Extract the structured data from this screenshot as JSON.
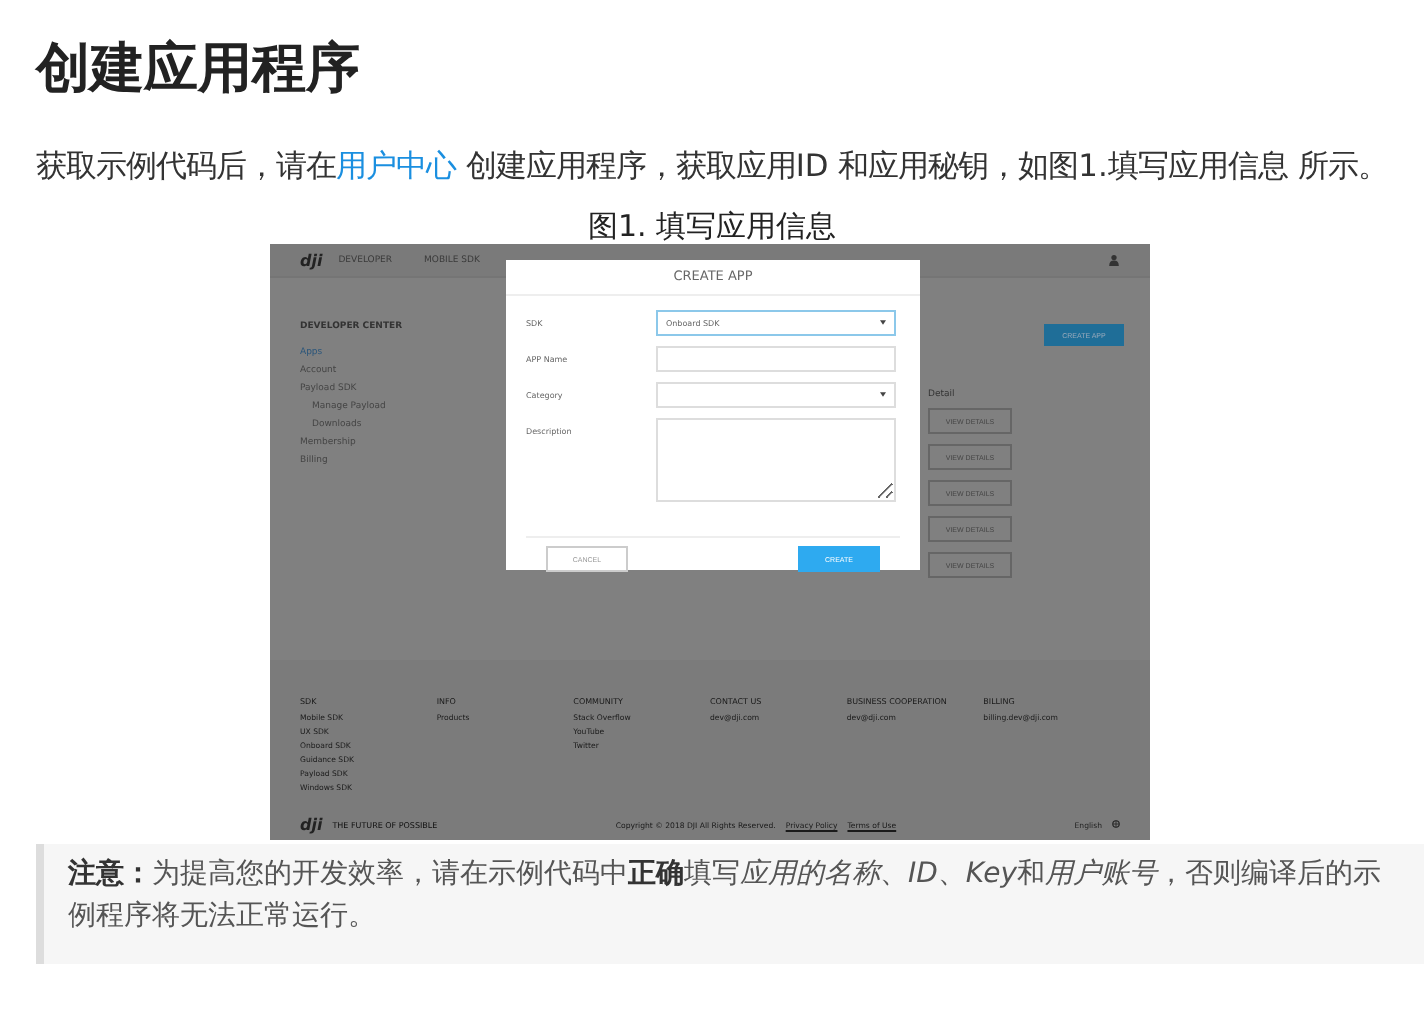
{
  "title": "创建应用程序",
  "intro": {
    "before": "获取示例代码后，请在",
    "link": "用户中心",
    "after": " 创建应用程序，获取应用ID 和应用秘钥，如图1.填写应用信息 所示。"
  },
  "figure_caption": "图1. 填写应用信息",
  "screenshot": {
    "nav": {
      "logo": "dji",
      "brand": "DEVELOPER",
      "items": [
        "MOBILE SDK"
      ]
    },
    "sidebar": {
      "heading": "DEVELOPER CENTER",
      "items": [
        {
          "label": "Apps",
          "selected": true
        },
        {
          "label": "Account",
          "selected": false
        },
        {
          "label": "Payload SDK",
          "selected": false,
          "children": [
            {
              "label": "Manage Payload",
              "selected": false
            },
            {
              "label": "Downloads",
              "selected": false
            }
          ]
        },
        {
          "label": "Membership",
          "selected": false
        },
        {
          "label": "Billing",
          "selected": false
        }
      ]
    },
    "create_button": "CREATE APP",
    "detail_heading": "Detail",
    "detail_buttons": [
      "VIEW DETAILS",
      "VIEW DETAILS",
      "VIEW DETAILS",
      "VIEW DETAILS",
      "VIEW DETAILS"
    ],
    "footer": {
      "columns": [
        {
          "heading": "SDK",
          "links": [
            "Mobile SDK",
            "UX SDK",
            "Onboard SDK",
            "Guidance SDK",
            "Payload SDK",
            "Windows SDK"
          ]
        },
        {
          "heading": "INFO",
          "links": [
            "Products"
          ]
        },
        {
          "heading": "COMMUNITY",
          "links": [
            "Stack Overflow",
            "YouTube",
            "Twitter"
          ]
        },
        {
          "heading": "CONTACT US",
          "links": [
            "dev@dji.com"
          ]
        },
        {
          "heading": "BUSINESS COOPERATION",
          "links": [
            "dev@dji.com"
          ]
        },
        {
          "heading": "BILLING",
          "links": [
            "billing.dev@dji.com"
          ]
        }
      ],
      "logo": "dji",
      "tagline": "THE FUTURE OF POSSIBLE",
      "copyright": "Copyright © 2018 DJI All Rights Reserved.",
      "links": [
        "Privacy Policy",
        "Terms of Use"
      ],
      "language": "English"
    },
    "modal": {
      "title": "CREATE APP",
      "fields": [
        {
          "label": "SDK",
          "kind": "select",
          "value": "Onboard SDK",
          "focused": true
        },
        {
          "label": "APP Name",
          "kind": "text",
          "focused": false
        },
        {
          "label": "Category",
          "kind": "select",
          "focused": false
        },
        {
          "label": "Description",
          "kind": "textarea",
          "focused": false
        }
      ],
      "cancel": "CANCEL",
      "create": "CREATE"
    }
  },
  "note": {
    "label": "注意：",
    "segments": [
      {
        "text": "为提高您的开发效率，请在示例代码中",
        "kind": "plain"
      },
      {
        "text": "正确",
        "kind": "bold"
      },
      {
        "text": "填写",
        "kind": "plain"
      },
      {
        "text": "应用的名称",
        "kind": "italic"
      },
      {
        "text": "、",
        "kind": "plain"
      },
      {
        "text": "ID",
        "kind": "italic"
      },
      {
        "text": "、",
        "kind": "plain"
      },
      {
        "text": "Key",
        "kind": "italic"
      },
      {
        "text": "和",
        "kind": "plain"
      },
      {
        "text": "用户账号",
        "kind": "italic"
      },
      {
        "text": "，否则编译后的示例程序将无法正常运行。",
        "kind": "plain"
      }
    ]
  }
}
